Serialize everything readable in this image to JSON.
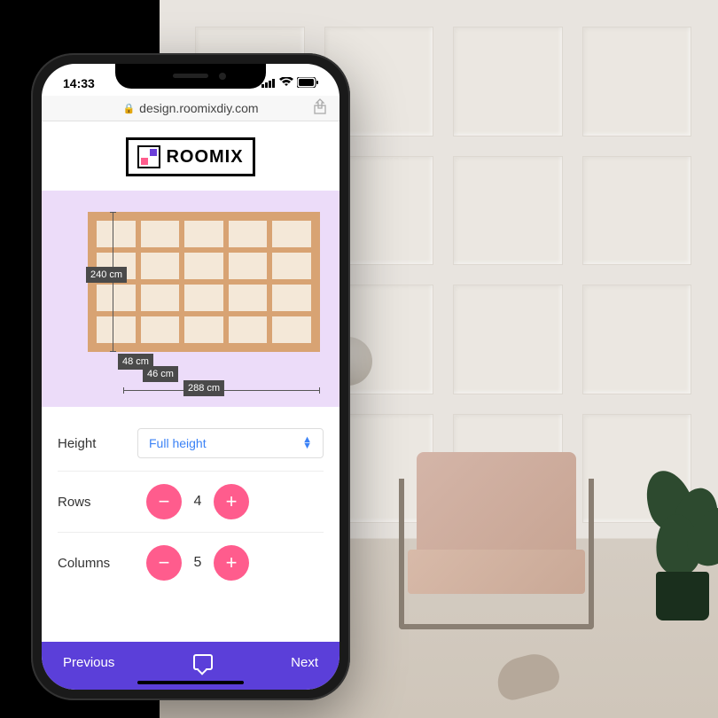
{
  "status_bar": {
    "time": "14:33"
  },
  "browser": {
    "url": "design.roomixdiy.com"
  },
  "logo": {
    "text": "ROOMIX"
  },
  "preview": {
    "height_cm": "240 cm",
    "sub_height_cm": "48 cm",
    "sub_width_cm": "46 cm",
    "width_cm": "288 cm",
    "rows": 4,
    "columns": 5
  },
  "controls": {
    "height": {
      "label": "Height",
      "value": "Full height"
    },
    "rows": {
      "label": "Rows",
      "value": "4"
    },
    "columns": {
      "label": "Columns",
      "value": "5"
    }
  },
  "nav": {
    "previous": "Previous",
    "next": "Next"
  },
  "colors": {
    "accent": "#5b3fd9",
    "stepper": "#ff5c8d",
    "link": "#3b82f6",
    "preview_bg": "#ecdcf9",
    "panel_frame": "#d8a373"
  }
}
